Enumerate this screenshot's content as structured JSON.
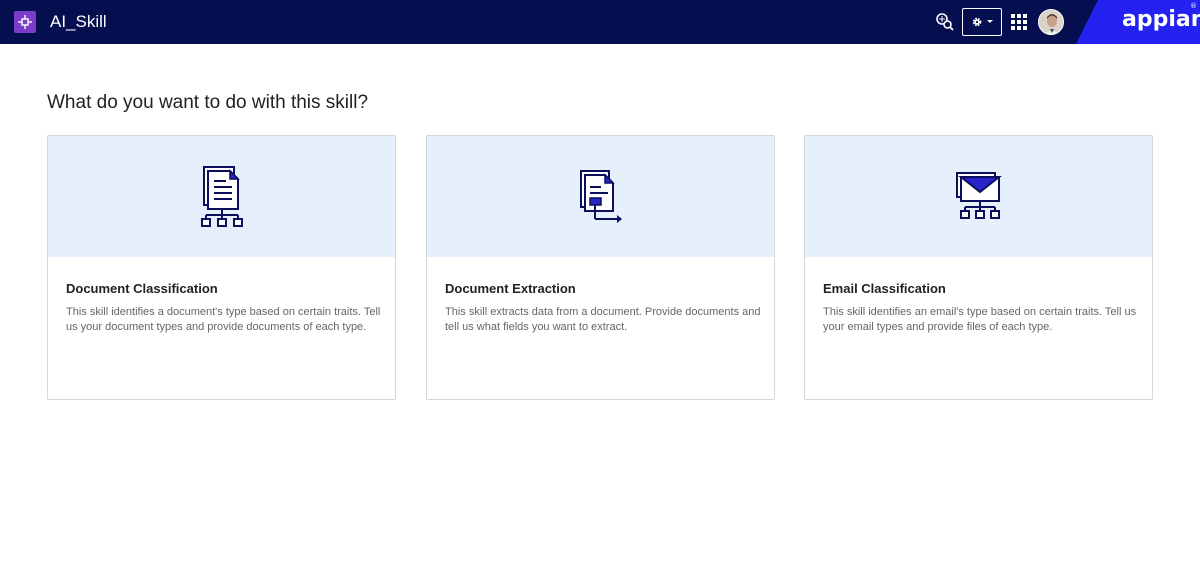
{
  "header": {
    "app_title": "AI_Skill",
    "brand": "appian",
    "brand_mark": "®",
    "icons": {
      "app_logo": "puzzle-icon",
      "search": "search-icon",
      "settings": "gear-icon",
      "settings_dropdown": "caret-down-icon",
      "apps": "grid-icon",
      "avatar": "user-avatar"
    },
    "colors": {
      "bar": "#050e4f",
      "brand_accent": "#2322f0",
      "app_logo": "#7a3cc9"
    }
  },
  "main": {
    "heading": "What do you want to do with this skill?",
    "cards": [
      {
        "title": "Document Classification",
        "description": "This skill identifies a document's type based on certain traits. Tell us your document types and provide documents of each type.",
        "icon": "document-classification-icon"
      },
      {
        "title": "Document Extraction",
        "description": "This skill extracts data from a document. Provide documents and tell us what fields you want to extract.",
        "icon": "document-extraction-icon"
      },
      {
        "title": "Email Classification",
        "description": "This skill identifies an email's type based on certain traits. Tell us your email types and provide files of each type.",
        "icon": "email-classification-icon"
      }
    ],
    "colors": {
      "card_banner": "#e6effc",
      "icon_navy": "#0b0f5c",
      "icon_accent": "#2a25c9"
    }
  }
}
